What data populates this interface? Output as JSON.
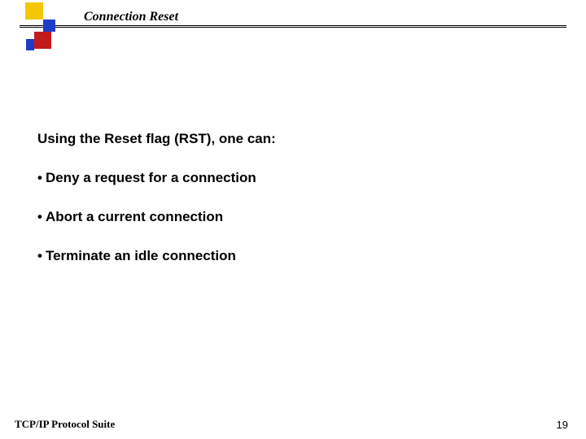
{
  "slide": {
    "title": "Connection Reset",
    "intro": "Using the Reset flag (RST), one can:",
    "bullets": [
      "Deny a request for a connection",
      "Abort a current connection",
      "Terminate an idle connection"
    ],
    "footer": "TCP/IP Protocol Suite",
    "page_number": "19",
    "bullet_glyph": "•"
  },
  "colors": {
    "yellow": "#f3c600",
    "blue": "#1f3cc9",
    "red": "#c21b1b"
  }
}
